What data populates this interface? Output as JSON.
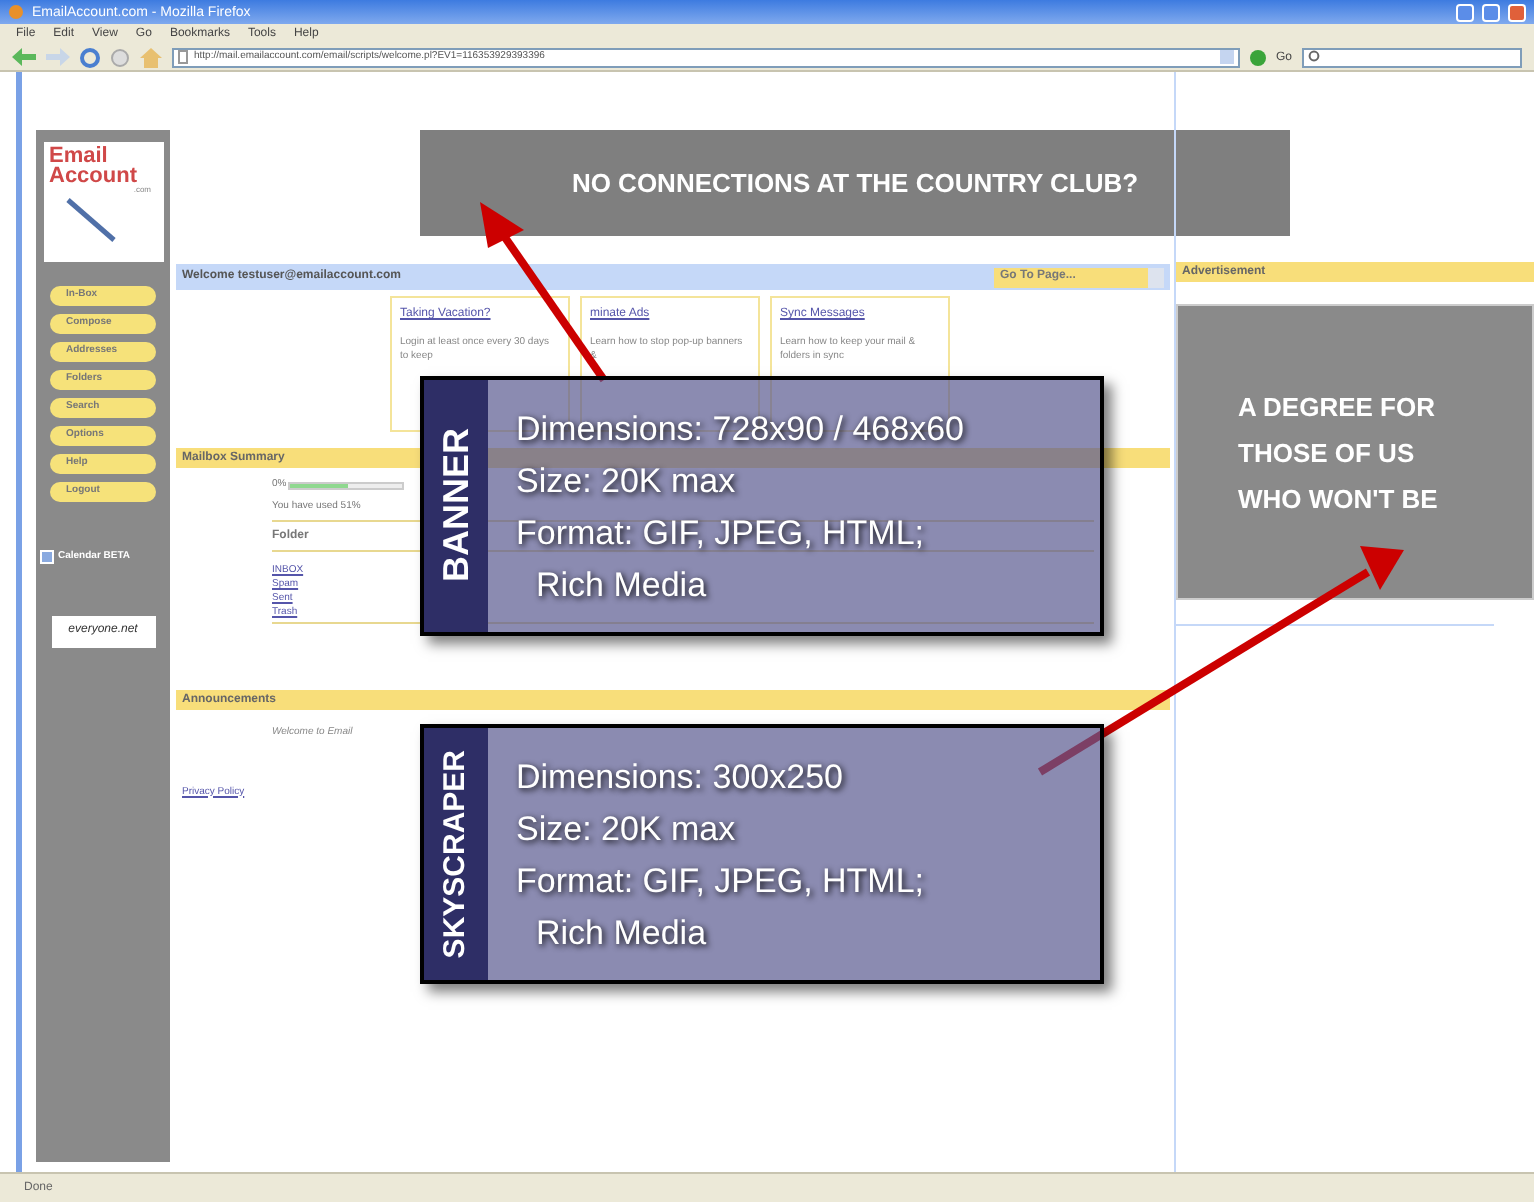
{
  "window": {
    "title": "EmailAccount.com - Mozilla Firefox"
  },
  "menu": [
    "File",
    "Edit",
    "View",
    "Go",
    "Bookmarks",
    "Tools",
    "Help"
  ],
  "address_bar": {
    "url": "http://mail.emailaccount.com/email/scripts/welcome.pl?EV1=116353929393396"
  },
  "go_button": "Go",
  "sidebar": {
    "logo": {
      "line_1": "Email",
      "line_2": "Account",
      "suffix": ".com"
    },
    "items": [
      {
        "label": "In-Box"
      },
      {
        "label": "Compose"
      },
      {
        "label": "Addresses"
      },
      {
        "label": "Folders"
      },
      {
        "label": "Search"
      },
      {
        "label": "Options"
      },
      {
        "label": "Help"
      },
      {
        "label": "Logout"
      }
    ],
    "calendar": "Calendar BETA",
    "badge": "everyone.net"
  },
  "banner_ad": "NO CONNECTIONS AT THE COUNTRY CLUB?",
  "welcome": {
    "text": "Welcome testuser@emailaccount.com",
    "dropdown": "Go To Page..."
  },
  "tips": [
    {
      "title": "Taking Vacation?",
      "body": "Login at least once every 30 days to keep"
    },
    {
      "title": "minate Ads",
      "body": "Learn how to stop pop-up banners &"
    },
    {
      "title": "Sync Messages",
      "body": "Learn how to keep your mail & folders in sync"
    }
  ],
  "mailbox": {
    "title": "Mailbox Summary",
    "usage": {
      "label": "0%",
      "level": 0.51
    },
    "used_text": "You have used 51%",
    "columns": [
      "Folder"
    ],
    "rows": [
      {
        "folder": "INBOX"
      },
      {
        "folder": "Spam"
      },
      {
        "folder": "Sent"
      },
      {
        "folder": "Trash"
      }
    ]
  },
  "announcements": {
    "title": "Announcements",
    "text": "Welcome to Email"
  },
  "privacy": "Privacy Policy",
  "advertisement": {
    "title": "Advertisement",
    "lines": [
      "A DEGREE FOR",
      "THOSE OF US",
      "WHO WON'T BE"
    ]
  },
  "callouts": [
    {
      "label": "BANNER",
      "lines": [
        "Dimensions: 728x90 / 468x60",
        "Size: 20K max",
        "Format: GIF, JPEG, HTML;",
        "Rich Media"
      ]
    },
    {
      "label": "SKYSCRAPER",
      "lines": [
        "Dimensions: 300x250",
        "Size: 20K max",
        "Format: GIF, JPEG, HTML;",
        "Rich Media"
      ]
    }
  ],
  "status_bar": "Done"
}
